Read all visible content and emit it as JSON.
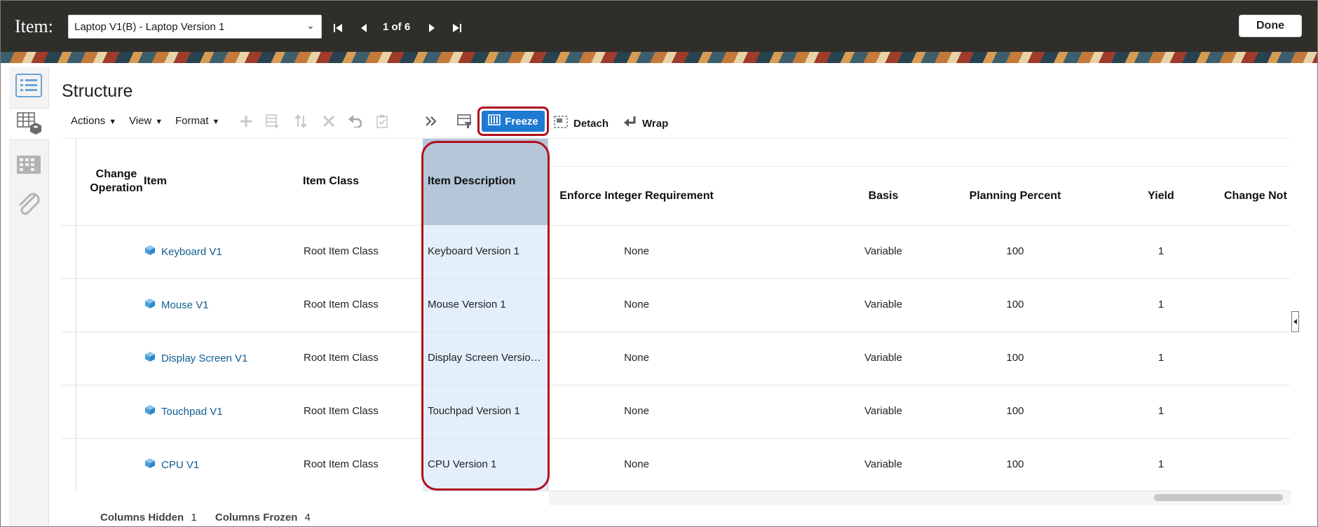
{
  "header": {
    "label": "Item:",
    "selected_item": "Laptop V1(B) - Laptop Version 1",
    "pager": "1 of 6",
    "done_label": "Done"
  },
  "page": {
    "title": "Structure"
  },
  "toolbar": {
    "actions": "Actions",
    "view": "View",
    "format": "Format",
    "freeze": "Freeze",
    "detach": "Detach",
    "wrap": "Wrap"
  },
  "table": {
    "headers": {
      "change_operation_1": "Change",
      "change_operation_2": "Operation",
      "item": "Item",
      "item_class": "Item Class",
      "item_description": "Item Description",
      "enforce_integer": "Enforce Integer Requirement",
      "basis": "Basis",
      "planning_percent": "Planning Percent",
      "yield": "Yield",
      "change_notice": "Change Not"
    },
    "rows": [
      {
        "item": "Keyboard V1",
        "item_class": "Root Item Class",
        "description": "Keyboard Version 1",
        "enforce": "None",
        "basis": "Variable",
        "planning": "100",
        "yield": "1"
      },
      {
        "item": "Mouse V1",
        "item_class": "Root Item Class",
        "description": "Mouse Version 1",
        "enforce": "None",
        "basis": "Variable",
        "planning": "100",
        "yield": "1"
      },
      {
        "item": "Display Screen V1",
        "item_class": "Root Item Class",
        "description": "Display Screen Versio…",
        "enforce": "None",
        "basis": "Variable",
        "planning": "100",
        "yield": "1"
      },
      {
        "item": "Touchpad V1",
        "item_class": "Root Item Class",
        "description": "Touchpad Version 1",
        "enforce": "None",
        "basis": "Variable",
        "planning": "100",
        "yield": "1"
      },
      {
        "item": "CPU V1",
        "item_class": "Root Item Class",
        "description": "CPU Version 1",
        "enforce": "None",
        "basis": "Variable",
        "planning": "100",
        "yield": "1"
      }
    ]
  },
  "footer": {
    "hidden_label": "Columns Hidden",
    "hidden_value": "1",
    "frozen_label": "Columns Frozen",
    "frozen_value": "4"
  },
  "colors": {
    "accent": "#1f7ad2",
    "highlight_ring": "#b0101e",
    "link": "#0f5e93",
    "frozen_col": "#e3effb"
  }
}
